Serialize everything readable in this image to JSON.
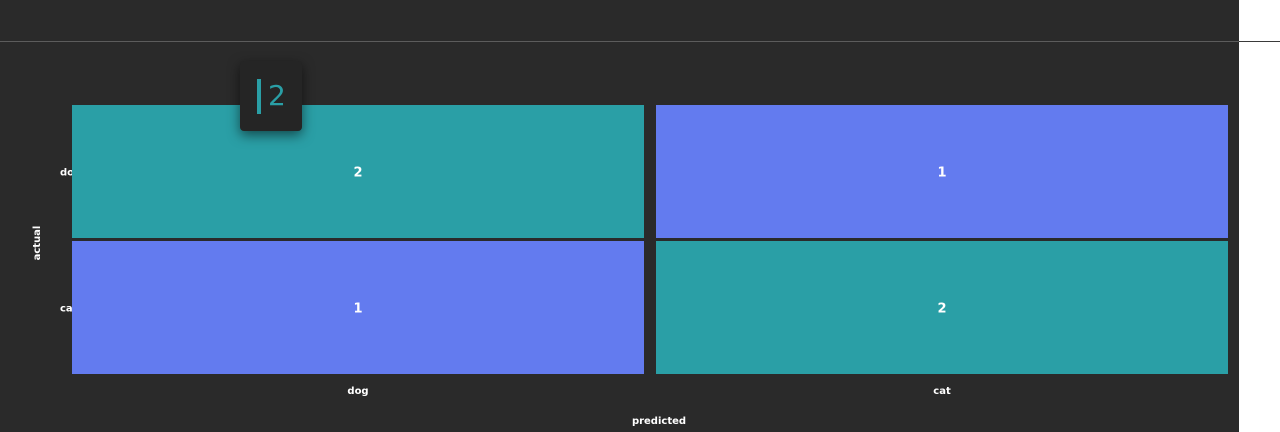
{
  "colors": {
    "background": "#2a2a2a",
    "teal": "#2a9fa6",
    "blue": "#637bef",
    "label": "#ffffff"
  },
  "chart_data": {
    "type": "heatmap",
    "xlabel": "predicted",
    "ylabel": "actual",
    "x_categories": [
      "dog",
      "cat"
    ],
    "y_categories": [
      "dog",
      "cat"
    ],
    "values": [
      [
        2,
        1
      ],
      [
        1,
        2
      ]
    ],
    "cell_colors": [
      [
        "#2a9fa6",
        "#637bef"
      ],
      [
        "#637bef",
        "#2a9fa6"
      ]
    ],
    "grid": false
  },
  "tooltip": {
    "value": "2"
  }
}
